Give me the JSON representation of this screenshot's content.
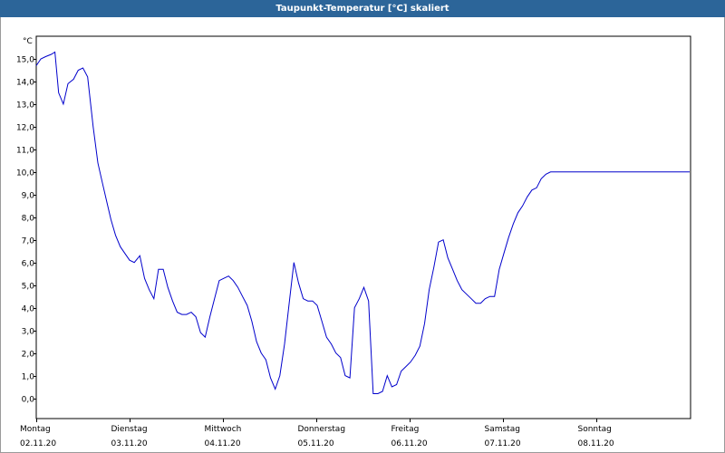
{
  "window": {
    "title": "Taupunkt-Temperatur [°C] skaliert"
  },
  "chart_data": {
    "type": "line",
    "title": "Taupunkt-Temperatur [°C] skaliert",
    "ylabel": "°C",
    "xlabel": "",
    "ylim": [
      -1.0,
      16.0
    ],
    "y_ticks": [
      "0,0",
      "1,0",
      "2,0",
      "3,0",
      "4,0",
      "5,0",
      "6,0",
      "7,0",
      "8,0",
      "9,0",
      "10,0",
      "11,0",
      "12,0",
      "13,0",
      "14,0",
      "15,0"
    ],
    "x_range_days": [
      0,
      7.0
    ],
    "x_ticks": [
      {
        "day": "Montag",
        "date": "02.11.20"
      },
      {
        "day": "Dienstag",
        "date": "03.11.20"
      },
      {
        "day": "Mittwoch",
        "date": "04.11.20"
      },
      {
        "day": "Donnerstag",
        "date": "05.11.20"
      },
      {
        "day": "Freitag",
        "date": "06.11.20"
      },
      {
        "day": "Samstag",
        "date": "07.11.20"
      },
      {
        "day": "Sonntag",
        "date": "08.11.20"
      }
    ],
    "grid": true,
    "line_color": "#0000cc",
    "series": [
      {
        "x": [
          0.0,
          0.05,
          0.1,
          0.16,
          0.2,
          0.24,
          0.29,
          0.34,
          0.4,
          0.45,
          0.5,
          0.55,
          0.61,
          0.66,
          0.71,
          0.76,
          0.8,
          0.85,
          0.9,
          0.95,
          1.0,
          1.05,
          1.11,
          1.16,
          1.21,
          1.26,
          1.31,
          1.36,
          1.41,
          1.46,
          1.51,
          1.56,
          1.61,
          1.66,
          1.71,
          1.76,
          1.81,
          1.86,
          1.91,
          1.96,
          2.01,
          2.06,
          2.11,
          2.16,
          2.21,
          2.26,
          2.31,
          2.36,
          2.41,
          2.46,
          2.51,
          2.56,
          2.61,
          2.66,
          2.71,
          2.76,
          2.81,
          2.86,
          2.91,
          2.96,
          3.01,
          3.06,
          3.11,
          3.16,
          3.21,
          3.26,
          3.31,
          3.36,
          3.41,
          3.46,
          3.51,
          3.56,
          3.61,
          3.66,
          3.71,
          3.76,
          3.81,
          3.86,
          3.91,
          3.96,
          4.01,
          4.06,
          4.11,
          4.16,
          4.21,
          4.26,
          4.31,
          4.36,
          4.41,
          4.46,
          4.51,
          4.56,
          4.61,
          4.66,
          4.71,
          4.76,
          4.81,
          4.86,
          4.91,
          4.96,
          5.01,
          5.06,
          5.11,
          5.16,
          5.21,
          5.26,
          5.31,
          5.36,
          5.41,
          5.46,
          5.51,
          5.56,
          5.61,
          5.66,
          5.71,
          5.76,
          5.81,
          5.86,
          5.91,
          5.96,
          6.01,
          6.06,
          6.11,
          6.16,
          6.21,
          6.26,
          6.31,
          6.36,
          6.41,
          6.46,
          6.51,
          6.56,
          6.61,
          6.66,
          6.71,
          6.76,
          6.81,
          6.86,
          6.91,
          6.96,
          7.0
        ],
        "y": [
          14.7,
          15.0,
          15.1,
          15.2,
          15.3,
          13.5,
          13.0,
          13.9,
          14.1,
          14.5,
          14.6,
          14.2,
          12.0,
          10.4,
          9.5,
          8.6,
          7.9,
          7.2,
          6.7,
          6.4,
          6.1,
          6.0,
          6.3,
          5.3,
          4.8,
          4.4,
          5.7,
          5.7,
          4.9,
          4.3,
          3.8,
          3.7,
          3.7,
          3.8,
          3.6,
          2.9,
          2.7,
          3.6,
          4.4,
          5.2,
          5.3,
          5.4,
          5.2,
          4.9,
          4.5,
          4.1,
          3.4,
          2.5,
          2.0,
          1.7,
          0.9,
          0.4,
          1.0,
          2.4,
          4.2,
          6.0,
          5.1,
          4.4,
          4.3,
          4.3,
          4.1,
          3.4,
          2.7,
          2.4,
          2.0,
          1.8,
          1.0,
          0.9,
          4.0,
          4.4,
          4.9,
          4.3,
          0.2,
          0.2,
          0.3,
          1.0,
          0.5,
          0.6,
          1.2,
          1.4,
          1.6,
          1.9,
          2.3,
          3.3,
          4.8,
          5.8,
          6.9,
          7.0,
          6.2,
          5.7,
          5.2,
          4.8,
          4.6,
          4.4,
          4.2,
          4.2,
          4.4,
          4.5,
          4.5,
          5.7,
          6.4,
          7.1,
          7.7,
          8.2,
          8.5,
          8.9,
          9.2,
          9.3,
          9.7,
          9.9,
          10.0,
          10.0,
          10.0,
          10.0,
          10.0,
          10.0,
          10.0,
          10.0,
          10.0,
          10.0,
          10.0,
          10.0,
          10.0,
          10.0,
          10.0,
          10.0,
          10.0,
          10.0,
          10.0,
          10.0,
          10.0,
          10.0,
          10.0,
          10.0,
          10.0,
          10.0,
          10.0,
          10.0,
          10.0,
          10.0,
          10.0
        ]
      }
    ]
  }
}
